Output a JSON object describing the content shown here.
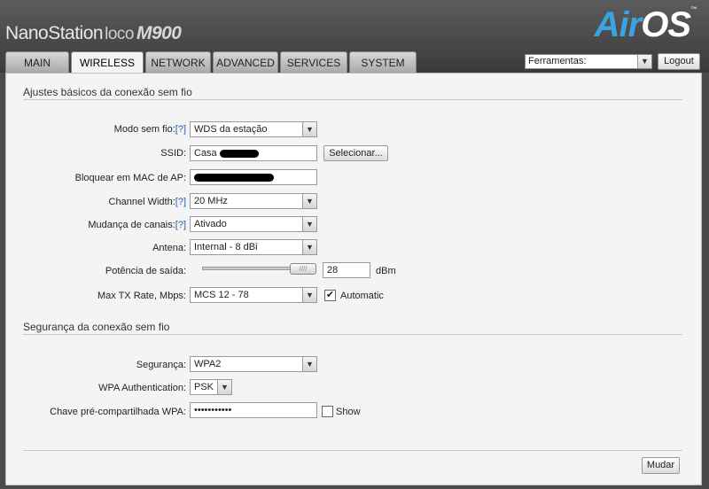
{
  "brand": {
    "name": "NanoStation",
    "loco": "loco",
    "model": "M900"
  },
  "airos": {
    "air": "Air",
    "os": "OS",
    "tm": "™"
  },
  "tabs": [
    "MAIN",
    "WIRELESS",
    "NETWORK",
    "ADVANCED",
    "SERVICES",
    "SYSTEM"
  ],
  "active_tab": "WIRELESS",
  "tools": {
    "selected": "Ferramentas:",
    "logout": "Logout"
  },
  "basic": {
    "title": "Ajustes básicos da conexão sem fio",
    "mode_label": "Modo sem fio:",
    "help": "[?]",
    "mode_value": "WDS da estação",
    "ssid_label": "SSID:",
    "ssid_value": "Casa",
    "select_button": "Selecionar...",
    "lock_label": "Bloquear em MAC de AP:",
    "width_label": "Channel Width:",
    "width_value": "20 MHz",
    "shift_label": "Mudança de canais:",
    "shift_value": "Ativado",
    "antenna_label": "Antena:",
    "antenna_value": "Internal - 8 dBi",
    "power_label": "Potência de saída:",
    "power_value": "28",
    "power_unit": "dBm",
    "rate_label": "Max TX Rate, Mbps:",
    "rate_value": "MCS 12 - 78",
    "automatic_label": "Automatic",
    "automatic_checked": "✔"
  },
  "security": {
    "title": "Segurança da conexão sem fio",
    "security_label": "Segurança:",
    "security_value": "WPA2",
    "auth_label": "WPA Authentication:",
    "auth_value": "PSK",
    "key_label": "Chave pré-compartilhada WPA:",
    "key_value": "•••••••••••",
    "show_label": "Show"
  },
  "footer": {
    "change_button": "Mudar"
  }
}
